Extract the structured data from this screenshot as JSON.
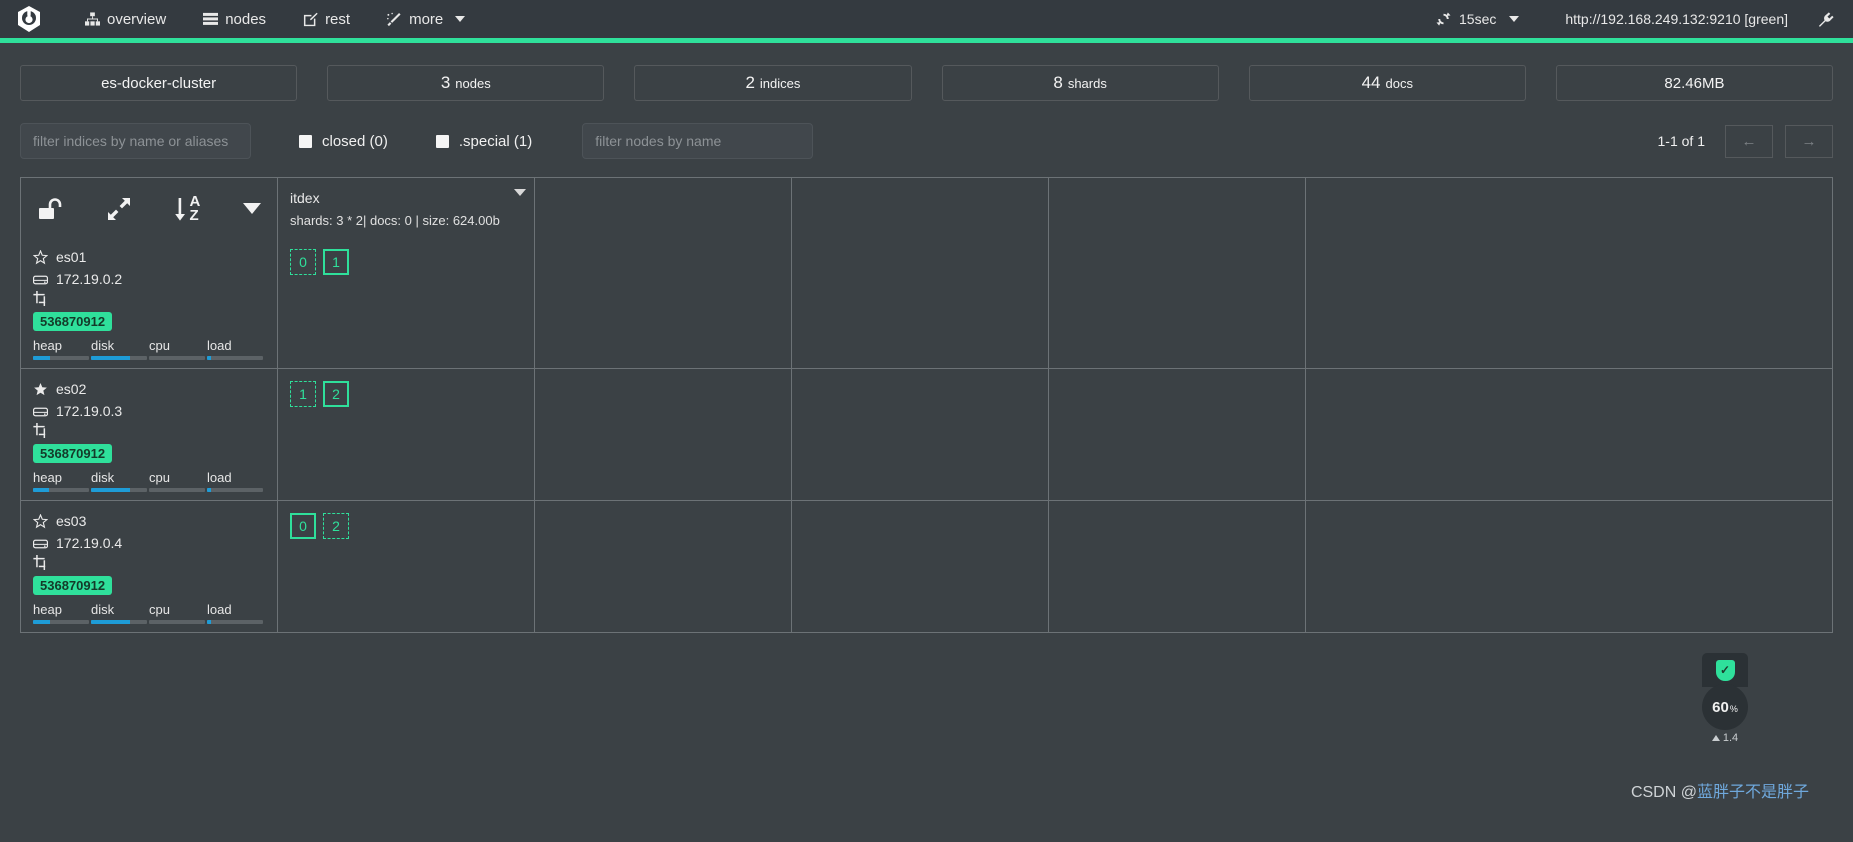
{
  "header": {
    "logo_name": "cerebro-logo",
    "nav": [
      {
        "label": "overview",
        "icon": "sitemap-icon"
      },
      {
        "label": "nodes",
        "icon": "server-rack-icon"
      },
      {
        "label": "rest",
        "icon": "edit-square-icon"
      },
      {
        "label": "more",
        "icon": "magic-wand-icon"
      }
    ],
    "refresh_interval": "15sec",
    "refresh_icon": "refresh-icon",
    "cluster_url": "http://192.168.249.132:9210 [green]",
    "plug_icon": "plug-icon"
  },
  "stats": [
    {
      "name": "cluster-name",
      "value": "es-docker-cluster",
      "unit": ""
    },
    {
      "name": "nodes",
      "value": "3",
      "unit": "nodes"
    },
    {
      "name": "indices",
      "value": "2",
      "unit": "indices"
    },
    {
      "name": "shards",
      "value": "8",
      "unit": "shards"
    },
    {
      "name": "docs",
      "value": "44",
      "unit": "docs"
    },
    {
      "name": "store-size",
      "value": "82.46MB",
      "unit": ""
    }
  ],
  "filters": {
    "index_filter_placeholder": "filter indices by name or aliases",
    "index_filter_value": "",
    "node_filter_placeholder": "filter nodes by name",
    "node_filter_value": "",
    "closed_label": "closed (0)",
    "closed_checked": false,
    "special_label": ".special (1)",
    "special_checked": false,
    "pagination_text": "1-1 of 1",
    "prev_label": "←",
    "next_label": "→"
  },
  "table": {
    "header_icons": {
      "lock": "unlock-icon",
      "expand": "expand-arrows-icon",
      "sort": "sort-alpha-asc-icon",
      "sort_letter_top": "A",
      "sort_letter_bottom": "Z",
      "menu": "caret-down-icon"
    },
    "indices": [
      {
        "name": "itdex",
        "meta": "shards: 3 * 2| docs: 0 | size: 624.00b"
      }
    ],
    "nodes": [
      {
        "name": "es01",
        "master": false,
        "star_icon": "star-outline-icon",
        "ip": "172.19.0.2",
        "ip_icon": "hdd-icon",
        "role_icon": "crop-icon",
        "heap_badge": "536870912",
        "metrics": [
          {
            "label": "heap",
            "pct": 30
          },
          {
            "label": "disk",
            "pct": 70
          },
          {
            "label": "cpu",
            "pct": 0
          },
          {
            "label": "load",
            "pct": 8
          }
        ],
        "shards": [
          {
            "value": "0",
            "type": "replica"
          },
          {
            "value": "1",
            "type": "primary"
          }
        ]
      },
      {
        "name": "es02",
        "master": true,
        "star_icon": "star-filled-icon",
        "ip": "172.19.0.3",
        "ip_icon": "hdd-icon",
        "role_icon": "crop-icon",
        "heap_badge": "536870912",
        "metrics": [
          {
            "label": "heap",
            "pct": 28
          },
          {
            "label": "disk",
            "pct": 70
          },
          {
            "label": "cpu",
            "pct": 0
          },
          {
            "label": "load",
            "pct": 8
          }
        ],
        "shards": [
          {
            "value": "1",
            "type": "replica"
          },
          {
            "value": "2",
            "type": "primary"
          }
        ]
      },
      {
        "name": "es03",
        "master": false,
        "star_icon": "star-outline-icon",
        "ip": "172.19.0.4",
        "ip_icon": "hdd-icon",
        "role_icon": "crop-icon",
        "heap_badge": "536870912",
        "metrics": [
          {
            "label": "heap",
            "pct": 30
          },
          {
            "label": "disk",
            "pct": 70
          },
          {
            "label": "cpu",
            "pct": 0
          },
          {
            "label": "load",
            "pct": 8
          }
        ],
        "shards": [
          {
            "value": "0",
            "type": "primary"
          },
          {
            "value": "2",
            "type": "replica"
          }
        ]
      }
    ]
  },
  "security_widget": {
    "shield_icon": "shield-check-icon",
    "score": "60",
    "score_unit": "%",
    "sub_value": "1.4",
    "trend_icon": "triangle-up-icon"
  },
  "watermark": {
    "prefix": "CSDN @",
    "author": "蓝胖子不是胖子"
  },
  "colors": {
    "accent_green": "#2fe09b",
    "header_bg": "#343a40",
    "body_bg": "#3b4145",
    "metric_blue": "#1e9cd7"
  }
}
